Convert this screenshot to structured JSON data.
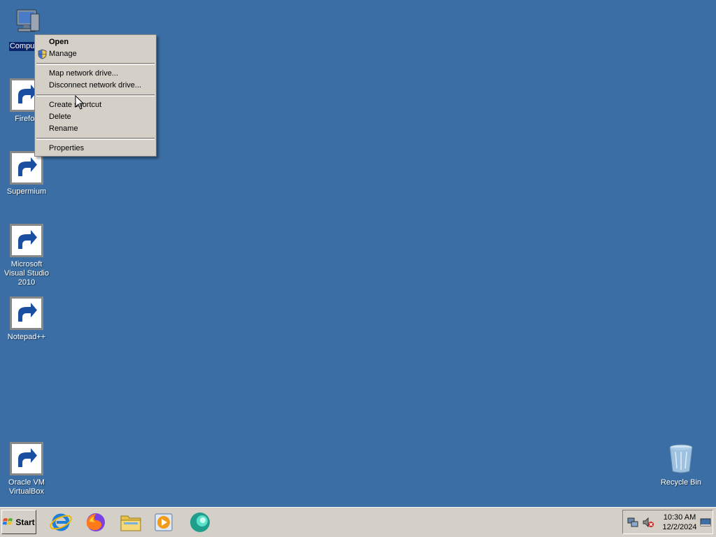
{
  "desktop": {
    "background": "#3a6ea5",
    "icons": [
      {
        "label": "Computer",
        "icon": "computer-icon",
        "selected": true
      },
      {
        "label": "Firefox",
        "icon": "firefox-icon"
      },
      {
        "label": "Supermium",
        "icon": "supermium-icon"
      },
      {
        "label": "Microsoft Visual Studio 2010",
        "icon": "visual-studio-icon"
      },
      {
        "label": "Notepad++",
        "icon": "notepadpp-icon"
      },
      {
        "label": "Oracle VM VirtualBox",
        "icon": "virtualbox-icon"
      },
      {
        "label": "Recycle Bin",
        "icon": "recycle-bin-icon"
      }
    ]
  },
  "context_menu": {
    "items": [
      {
        "label": "Open",
        "bold": true
      },
      {
        "label": "Manage",
        "icon": "shield-icon"
      },
      {
        "label": "Map network drive..."
      },
      {
        "label": "Disconnect network drive..."
      },
      {
        "label": "Create shortcut"
      },
      {
        "label": "Delete"
      },
      {
        "label": "Rename"
      },
      {
        "label": "Properties"
      }
    ]
  },
  "taskbar": {
    "start_label": "Start",
    "quick_launch": [
      {
        "name": "internet-explorer-icon"
      },
      {
        "name": "firefox-icon"
      },
      {
        "name": "file-explorer-icon"
      },
      {
        "name": "media-player-icon"
      },
      {
        "name": "supermium-icon"
      }
    ],
    "tray": {
      "icons": [
        "network-icon",
        "volume-muted-icon",
        "show-desktop-icon"
      ],
      "time": "10:30 AM",
      "date": "12/2/2024"
    }
  }
}
